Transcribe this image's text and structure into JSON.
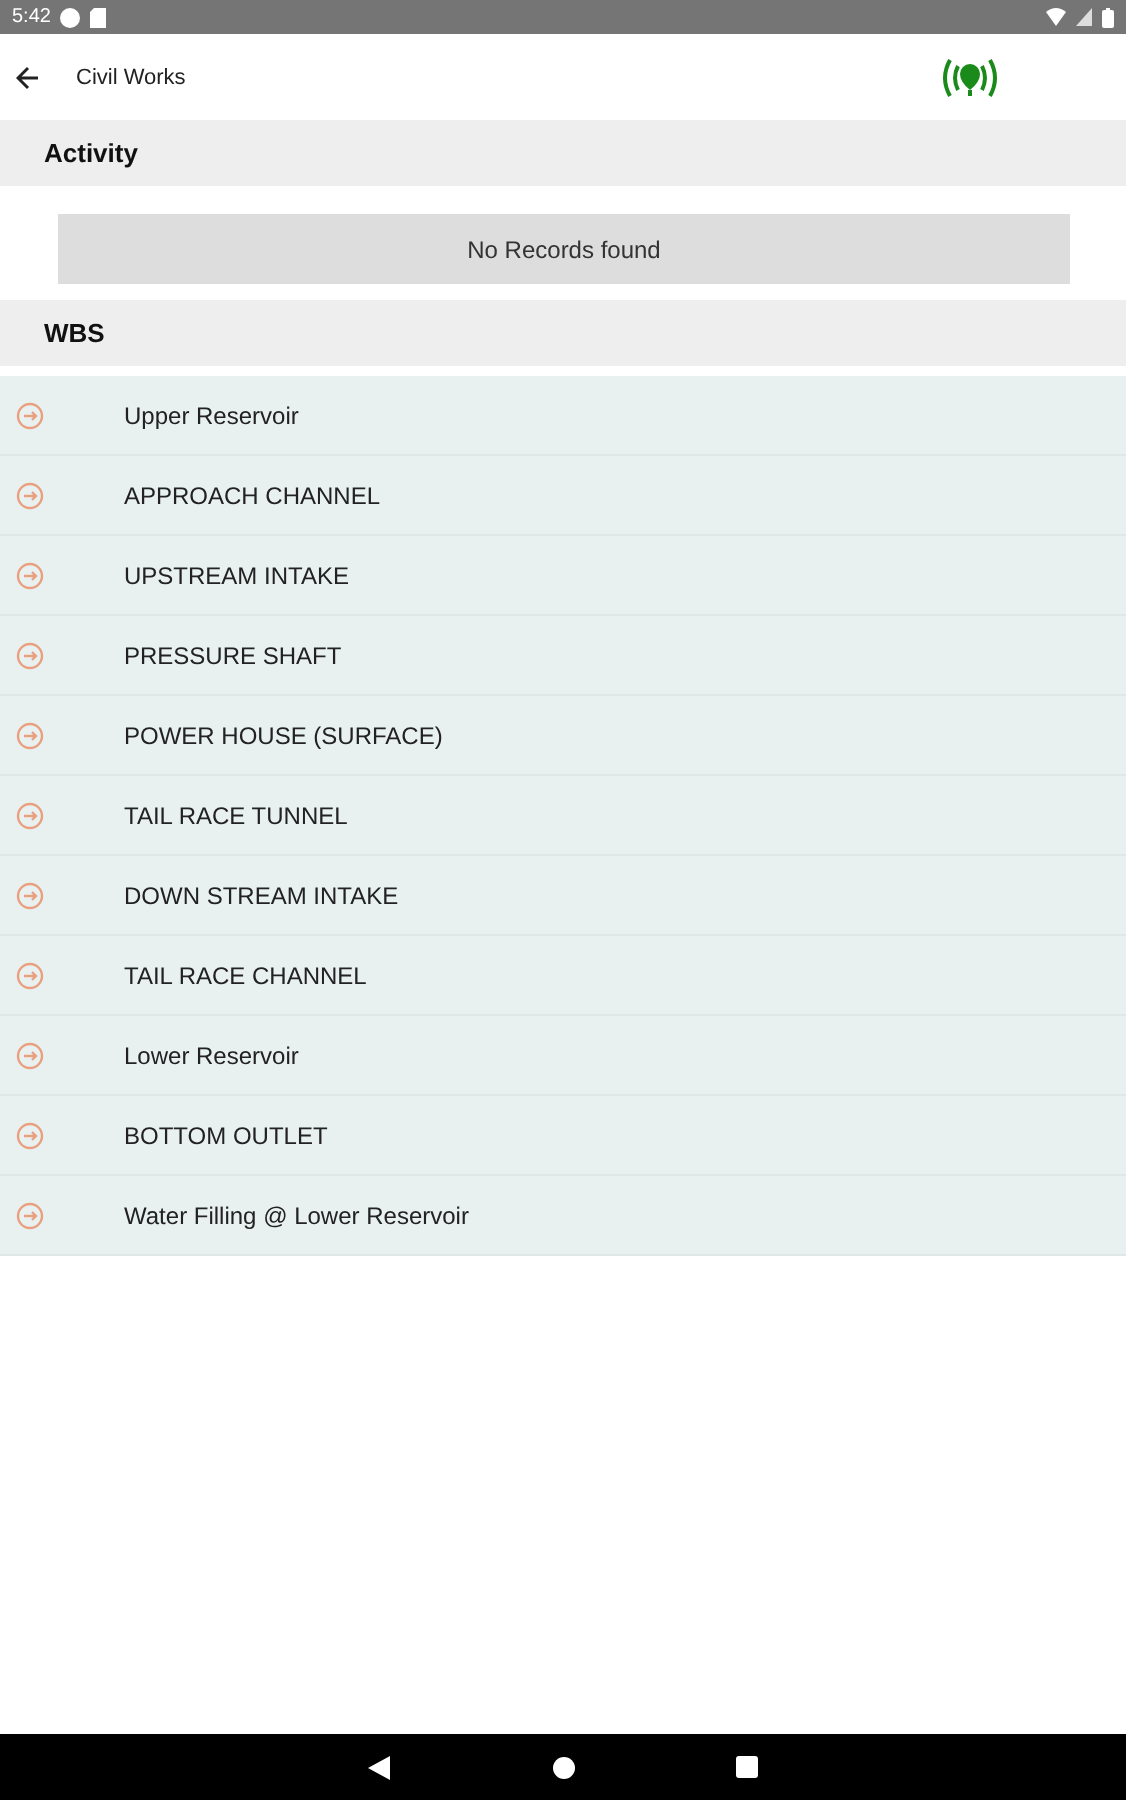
{
  "status_bar": {
    "time": "5:42"
  },
  "app_bar": {
    "title": "Civil Works"
  },
  "activity": {
    "heading": "Activity",
    "empty_message": "No Records found"
  },
  "wbs": {
    "heading": "WBS",
    "items": [
      {
        "label": "Upper Reservoir"
      },
      {
        "label": "APPROACH CHANNEL"
      },
      {
        "label": "UPSTREAM INTAKE"
      },
      {
        "label": "PRESSURE SHAFT"
      },
      {
        "label": "POWER HOUSE (SURFACE)"
      },
      {
        "label": "TAIL RACE TUNNEL"
      },
      {
        "label": "DOWN STREAM INTAKE"
      },
      {
        "label": "TAIL RACE CHANNEL"
      },
      {
        "label": "Lower Reservoir"
      },
      {
        "label": "BOTTOM OUTLET"
      },
      {
        "label": "Water Filling @ Lower Reservoir"
      }
    ]
  }
}
